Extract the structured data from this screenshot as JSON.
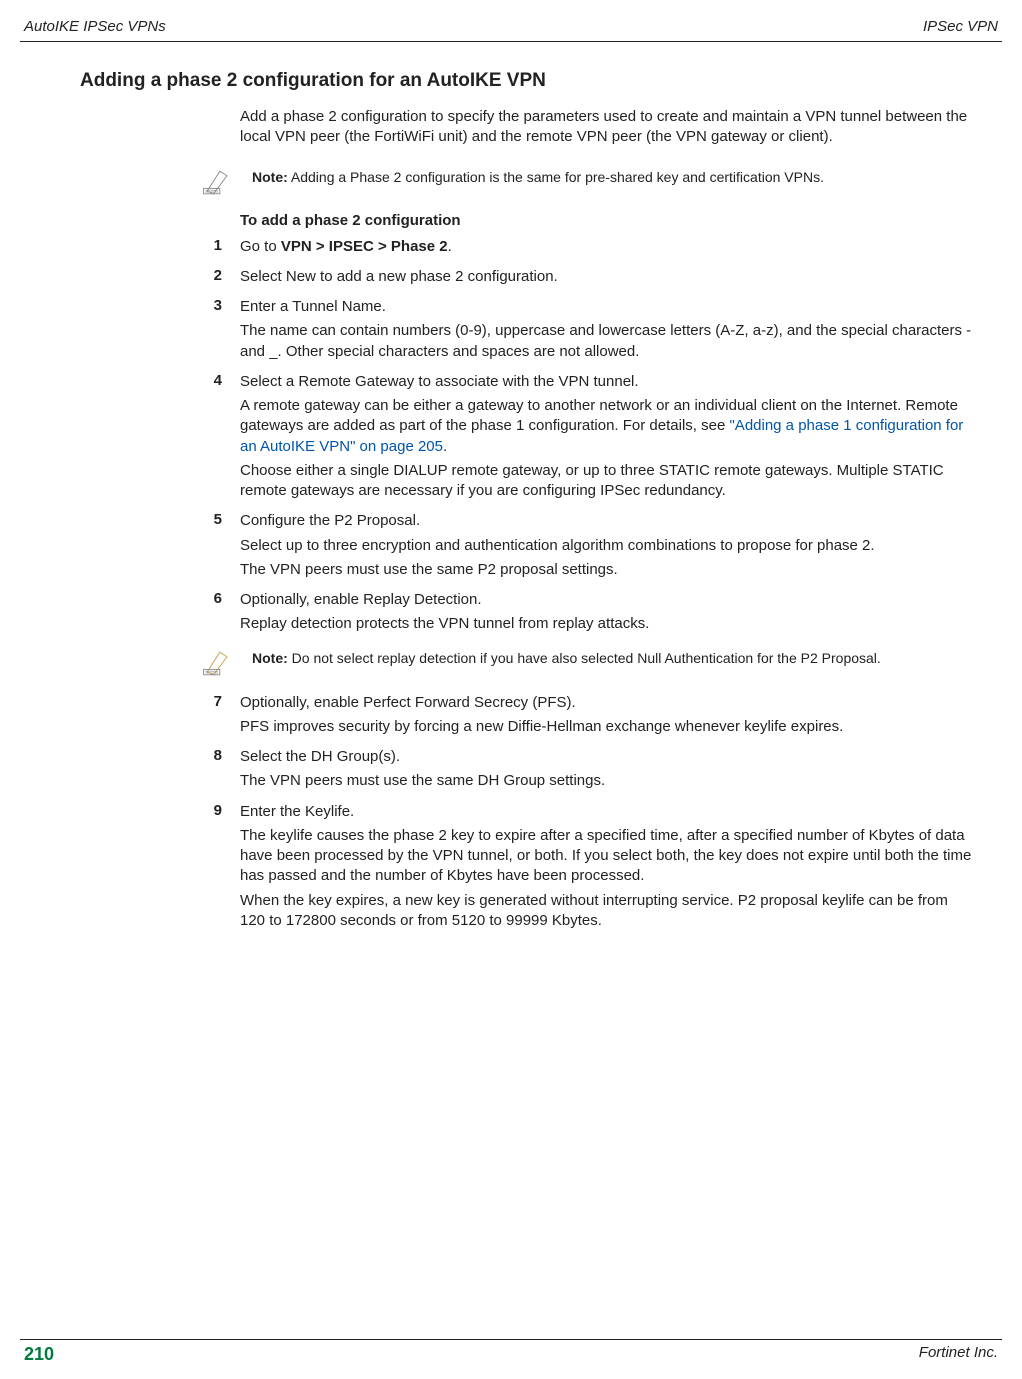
{
  "header": {
    "left": "AutoIKE IPSec VPNs",
    "right": "IPSec VPN"
  },
  "section": {
    "title": "Adding a phase 2 configuration for an AutoIKE VPN",
    "intro": "Add a phase 2 configuration to specify the parameters used to create and maintain a VPN tunnel between the local VPN peer (the FortiWiFi unit) and the remote VPN peer (the VPN gateway or client)."
  },
  "note1": {
    "label": "Note:",
    "text": " Adding a Phase 2 configuration is the same for pre-shared key and certification VPNs."
  },
  "subheading": "To add a phase 2 configuration",
  "steps": {
    "s1": {
      "num": "1",
      "a_pre": "Go to ",
      "a_bold": "VPN > IPSEC > Phase 2",
      "a_post": "."
    },
    "s2": {
      "num": "2",
      "a": "Select New to add a new phase 2 configuration."
    },
    "s3": {
      "num": "3",
      "a": "Enter a Tunnel Name.",
      "b": "The name can contain numbers (0-9), uppercase and lowercase letters (A-Z, a-z), and the special characters - and _. Other special characters and spaces are not allowed."
    },
    "s4": {
      "num": "4",
      "a": "Select a Remote Gateway to associate with the VPN tunnel.",
      "b_pre": "A remote gateway can be either a gateway to another network or an individual client on the Internet. Remote gateways are added as part of the phase 1 configuration. For details, see ",
      "b_link": "\"Adding a phase 1 configuration for an AutoIKE VPN\" on page 205",
      "b_post": ".",
      "c": "Choose either a single DIALUP remote gateway, or up to three STATIC remote gateways. Multiple STATIC remote gateways are necessary if you are configuring IPSec redundancy."
    },
    "s5": {
      "num": "5",
      "a": "Configure the P2 Proposal.",
      "b": "Select up to three encryption and authentication algorithm combinations to propose for phase 2.",
      "c": "The VPN peers must use the same P2 proposal settings."
    },
    "s6": {
      "num": "6",
      "a": "Optionally, enable Replay Detection.",
      "b": "Replay detection protects the VPN tunnel from replay attacks."
    }
  },
  "note2": {
    "label": "Note:",
    "text": " Do not select replay detection if you have also selected Null Authentication for the P2 Proposal."
  },
  "steps2": {
    "s7": {
      "num": "7",
      "a": "Optionally, enable Perfect Forward Secrecy (PFS).",
      "b": "PFS improves security by forcing a new Diffie-Hellman exchange whenever keylife expires."
    },
    "s8": {
      "num": "8",
      "a": "Select the DH Group(s).",
      "b": "The VPN peers must use the same DH Group settings."
    },
    "s9": {
      "num": "9",
      "a": "Enter the Keylife.",
      "b": "The keylife causes the phase 2 key to expire after a specified time, after a specified number of Kbytes of data have been processed by the VPN tunnel, or both. If you select both, the key does not expire until both the time has passed and the number of Kbytes have been processed.",
      "c": "When the key expires, a new key is generated without interrupting service. P2 proposal keylife can be from 120 to 172800 seconds or from 5120 to 99999 Kbytes."
    }
  },
  "footer": {
    "page": "210",
    "right": "Fortinet Inc."
  }
}
